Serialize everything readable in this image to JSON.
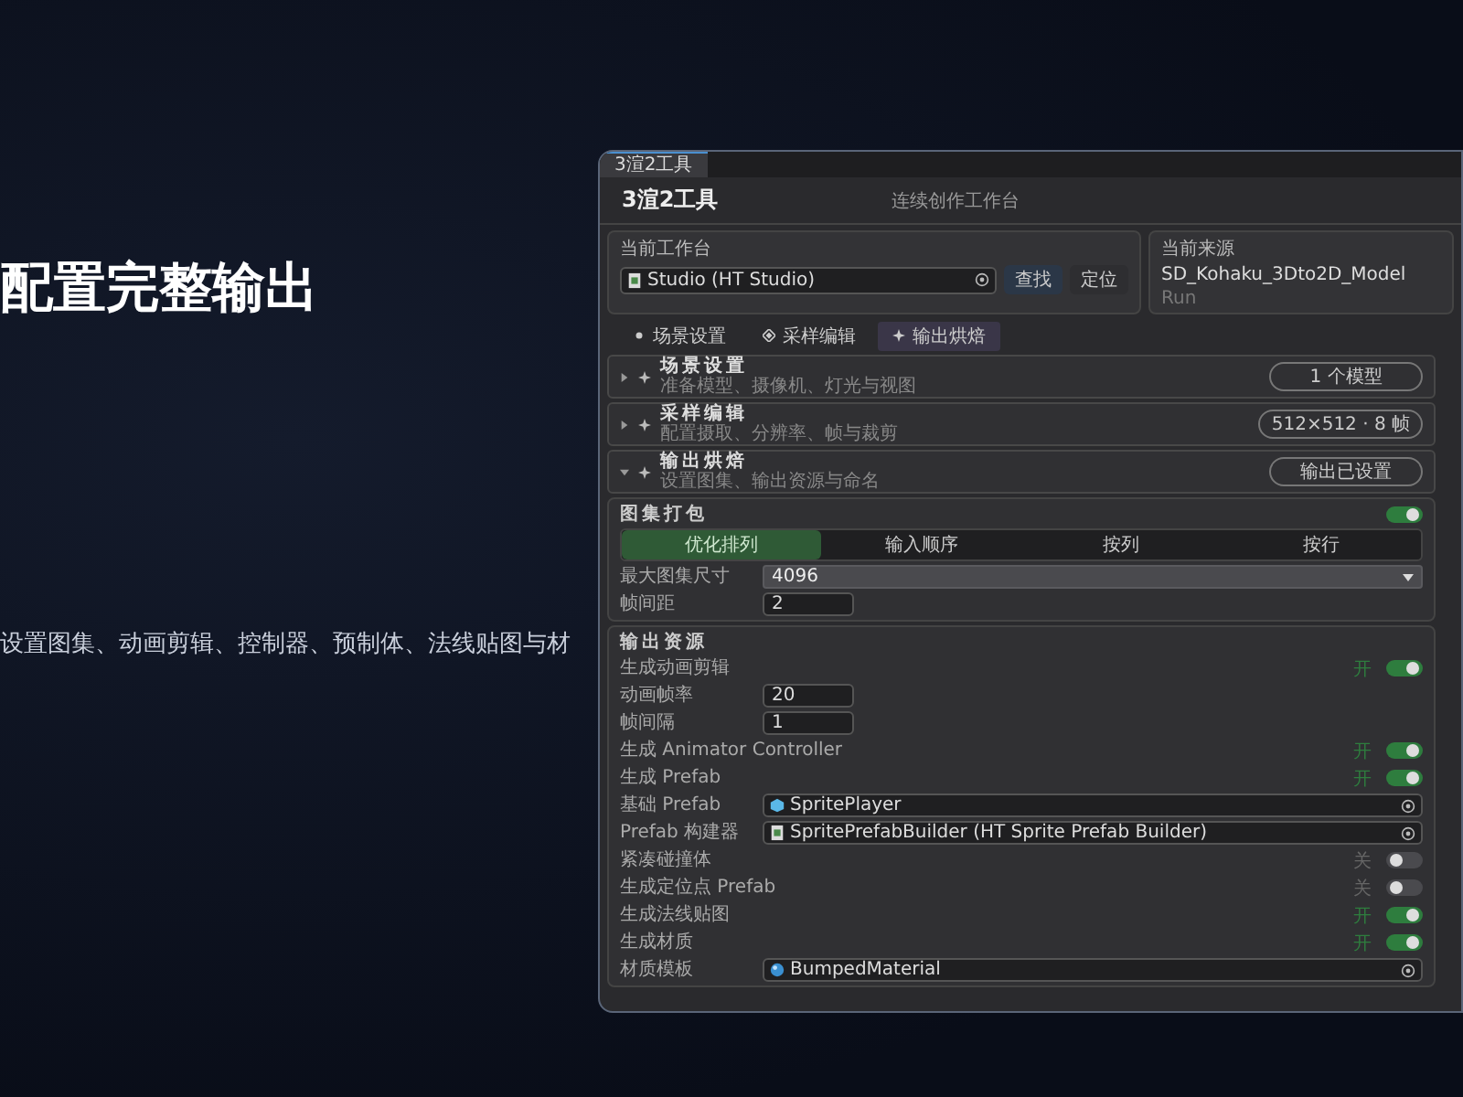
{
  "heading": "配置完整输出",
  "subtitle": "设置图集、动画剪辑、控制器、预制体、法线贴图与材",
  "panel": {
    "tab_label": "3渲2工具",
    "title": "3渲2工具",
    "subtitle": "连续创作工作台",
    "workspace": {
      "label": "当前工作台",
      "value": "Studio (HT Studio)",
      "buttons": [
        "查找",
        "定位"
      ]
    },
    "source": {
      "label": "当前来源",
      "name": "SD_Kohaku_3Dto2D_Model",
      "status": "Run"
    },
    "mode_tabs": [
      {
        "label": "场景设置",
        "selected": false
      },
      {
        "label": "采样编辑",
        "selected": false
      },
      {
        "label": "输出烘焙",
        "selected": true
      }
    ],
    "sections": [
      {
        "title": "场景设置",
        "desc": "准备模型、摄像机、灯光与视图",
        "badge": "1 个模型",
        "expanded": false
      },
      {
        "title": "采样编辑",
        "desc": "配置摄取、分辨率、帧与裁剪",
        "badge": "512×512 · 8 帧",
        "expanded": false
      },
      {
        "title": "输出烘焙",
        "desc": "设置图集、输出资源与命名",
        "badge": "输出已设置",
        "expanded": true
      }
    ],
    "atlas": {
      "title": "图集打包",
      "on": true,
      "order_tabs": [
        {
          "label": "优化排列",
          "selected": true
        },
        {
          "label": "输入顺序",
          "selected": false
        },
        {
          "label": "按列",
          "selected": false
        },
        {
          "label": "按行",
          "selected": false
        }
      ],
      "fields": [
        {
          "kind": "select",
          "label": "最大图集尺寸",
          "value": "4096"
        },
        {
          "kind": "number",
          "label": "帧间距",
          "value": "2"
        }
      ]
    },
    "output": {
      "title": "输出资源",
      "rows": [
        {
          "kind": "toggle",
          "label": "生成动画剪辑",
          "state_text": "开",
          "on": true
        },
        {
          "kind": "number",
          "label": "动画帧率",
          "value": "20"
        },
        {
          "kind": "number",
          "label": "帧间隔",
          "value": "1"
        },
        {
          "kind": "toggle",
          "label": "生成 Animator Controller",
          "state_text": "开",
          "on": true
        },
        {
          "kind": "toggle",
          "label": "生成 Prefab",
          "state_text": "开",
          "on": true
        },
        {
          "kind": "object",
          "label": "基础 Prefab",
          "value": "SpritePlayer"
        },
        {
          "kind": "object",
          "label": "Prefab 构建器",
          "value": "SpritePrefabBuilder (HT Sprite Prefab Builder)"
        },
        {
          "kind": "toggle",
          "label": "紧凑碰撞体",
          "state_text": "关",
          "on": false
        },
        {
          "kind": "toggle",
          "label": "生成定位点 Prefab",
          "state_text": "关",
          "on": false
        },
        {
          "kind": "toggle",
          "label": "生成法线贴图",
          "state_text": "开",
          "on": true
        },
        {
          "kind": "toggle",
          "label": "生成材质",
          "state_text": "开",
          "on": true
        },
        {
          "kind": "object",
          "label": "材质模板",
          "value": "BumpedMaterial"
        }
      ]
    }
  }
}
